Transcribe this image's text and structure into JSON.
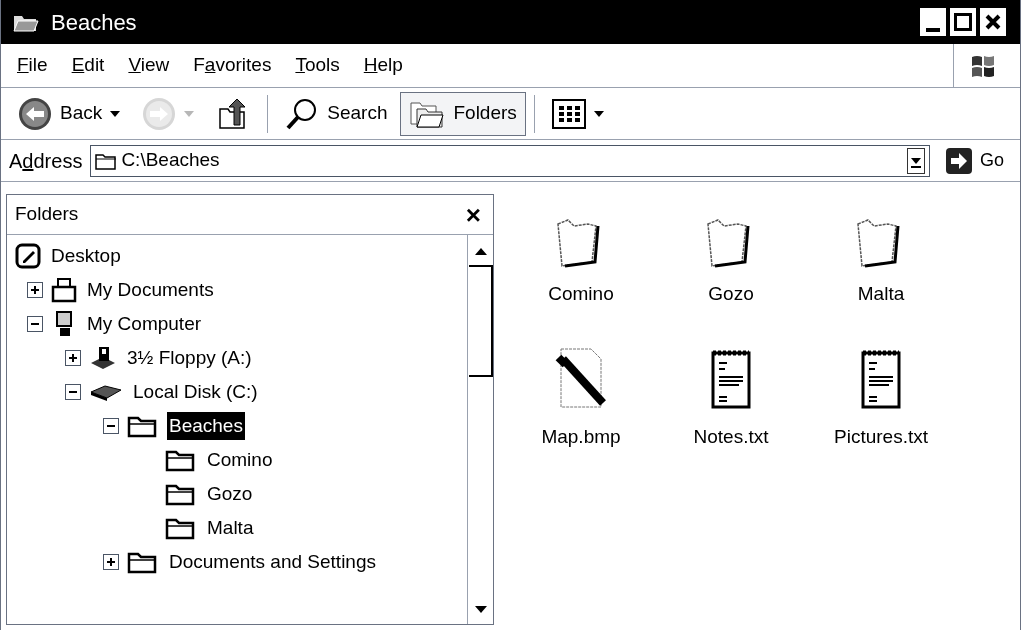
{
  "window": {
    "title": "Beaches"
  },
  "menu": [
    {
      "accel": "F",
      "rest": "ile"
    },
    {
      "accel": "E",
      "rest": "dit"
    },
    {
      "accel": "V",
      "rest": "iew"
    },
    {
      "lead": "F",
      "accel": "a",
      "rest": "vorites"
    },
    {
      "accel": "T",
      "rest": "ools"
    },
    {
      "accel": "H",
      "rest": "elp"
    }
  ],
  "toolbar": [
    {
      "kind": "back",
      "label": "Back",
      "disabled": false,
      "pressed": false
    },
    {
      "kind": "forward",
      "disabled": true,
      "pressed": false
    },
    {
      "kind": "up",
      "disabled": false,
      "pressed": false
    },
    {
      "kind": "search",
      "label": "Search",
      "disabled": false,
      "pressed": false
    },
    {
      "kind": "folders",
      "label": "Folders",
      "disabled": false,
      "pressed": true
    },
    {
      "kind": "views",
      "disabled": false,
      "pressed": false
    }
  ],
  "address": {
    "lead": "A",
    "accel": "d",
    "rest": "dress",
    "value": "C:\\Beaches",
    "go": "Go"
  },
  "folders_pane": {
    "title": "Folders",
    "close": "×",
    "tree": [
      {
        "kind": "desktop",
        "label": "Desktop",
        "selected": false,
        "children": [
          {
            "kind": "documents",
            "label": "My Documents",
            "expanded": false,
            "selected": false
          },
          {
            "kind": "computer",
            "label": "My Computer",
            "expanded": true,
            "selected": false,
            "children": [
              {
                "kind": "floppy",
                "label": "3½ Floppy (A:)",
                "expanded": false,
                "selected": false
              },
              {
                "kind": "disk",
                "label": "Local Disk (C:)",
                "expanded": true,
                "selected": false,
                "children": [
                  {
                    "kind": "folder",
                    "label": "Beaches",
                    "expanded": true,
                    "selected": true,
                    "children": [
                      {
                        "kind": "folder",
                        "label": "Comino",
                        "selected": false
                      },
                      {
                        "kind": "folder",
                        "label": "Gozo",
                        "selected": false
                      },
                      {
                        "kind": "folder",
                        "label": "Malta",
                        "selected": false
                      }
                    ]
                  },
                  {
                    "kind": "folder",
                    "label": "Documents and Settings",
                    "expanded": false,
                    "selected": false
                  }
                ]
              }
            ]
          }
        ]
      }
    ]
  },
  "files": [
    {
      "kind": "folder",
      "name": "Comino"
    },
    {
      "kind": "folder",
      "name": "Gozo"
    },
    {
      "kind": "folder",
      "name": "Malta"
    },
    {
      "kind": "bitmap",
      "name": "Map.bmp"
    },
    {
      "kind": "text",
      "name": "Notes.txt"
    },
    {
      "kind": "text",
      "name": "Pictures.txt"
    }
  ]
}
